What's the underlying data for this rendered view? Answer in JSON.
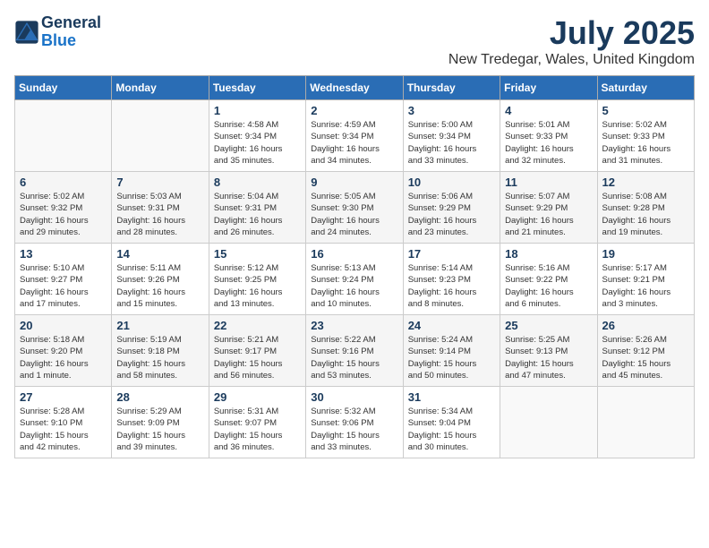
{
  "header": {
    "logo_line1": "General",
    "logo_line2": "Blue",
    "month_year": "July 2025",
    "location": "New Tredegar, Wales, United Kingdom"
  },
  "weekdays": [
    "Sunday",
    "Monday",
    "Tuesday",
    "Wednesday",
    "Thursday",
    "Friday",
    "Saturday"
  ],
  "weeks": [
    [
      {
        "day": "",
        "info": ""
      },
      {
        "day": "",
        "info": ""
      },
      {
        "day": "1",
        "info": "Sunrise: 4:58 AM\nSunset: 9:34 PM\nDaylight: 16 hours\nand 35 minutes."
      },
      {
        "day": "2",
        "info": "Sunrise: 4:59 AM\nSunset: 9:34 PM\nDaylight: 16 hours\nand 34 minutes."
      },
      {
        "day": "3",
        "info": "Sunrise: 5:00 AM\nSunset: 9:34 PM\nDaylight: 16 hours\nand 33 minutes."
      },
      {
        "day": "4",
        "info": "Sunrise: 5:01 AM\nSunset: 9:33 PM\nDaylight: 16 hours\nand 32 minutes."
      },
      {
        "day": "5",
        "info": "Sunrise: 5:02 AM\nSunset: 9:33 PM\nDaylight: 16 hours\nand 31 minutes."
      }
    ],
    [
      {
        "day": "6",
        "info": "Sunrise: 5:02 AM\nSunset: 9:32 PM\nDaylight: 16 hours\nand 29 minutes."
      },
      {
        "day": "7",
        "info": "Sunrise: 5:03 AM\nSunset: 9:31 PM\nDaylight: 16 hours\nand 28 minutes."
      },
      {
        "day": "8",
        "info": "Sunrise: 5:04 AM\nSunset: 9:31 PM\nDaylight: 16 hours\nand 26 minutes."
      },
      {
        "day": "9",
        "info": "Sunrise: 5:05 AM\nSunset: 9:30 PM\nDaylight: 16 hours\nand 24 minutes."
      },
      {
        "day": "10",
        "info": "Sunrise: 5:06 AM\nSunset: 9:29 PM\nDaylight: 16 hours\nand 23 minutes."
      },
      {
        "day": "11",
        "info": "Sunrise: 5:07 AM\nSunset: 9:29 PM\nDaylight: 16 hours\nand 21 minutes."
      },
      {
        "day": "12",
        "info": "Sunrise: 5:08 AM\nSunset: 9:28 PM\nDaylight: 16 hours\nand 19 minutes."
      }
    ],
    [
      {
        "day": "13",
        "info": "Sunrise: 5:10 AM\nSunset: 9:27 PM\nDaylight: 16 hours\nand 17 minutes."
      },
      {
        "day": "14",
        "info": "Sunrise: 5:11 AM\nSunset: 9:26 PM\nDaylight: 16 hours\nand 15 minutes."
      },
      {
        "day": "15",
        "info": "Sunrise: 5:12 AM\nSunset: 9:25 PM\nDaylight: 16 hours\nand 13 minutes."
      },
      {
        "day": "16",
        "info": "Sunrise: 5:13 AM\nSunset: 9:24 PM\nDaylight: 16 hours\nand 10 minutes."
      },
      {
        "day": "17",
        "info": "Sunrise: 5:14 AM\nSunset: 9:23 PM\nDaylight: 16 hours\nand 8 minutes."
      },
      {
        "day": "18",
        "info": "Sunrise: 5:16 AM\nSunset: 9:22 PM\nDaylight: 16 hours\nand 6 minutes."
      },
      {
        "day": "19",
        "info": "Sunrise: 5:17 AM\nSunset: 9:21 PM\nDaylight: 16 hours\nand 3 minutes."
      }
    ],
    [
      {
        "day": "20",
        "info": "Sunrise: 5:18 AM\nSunset: 9:20 PM\nDaylight: 16 hours\nand 1 minute."
      },
      {
        "day": "21",
        "info": "Sunrise: 5:19 AM\nSunset: 9:18 PM\nDaylight: 15 hours\nand 58 minutes."
      },
      {
        "day": "22",
        "info": "Sunrise: 5:21 AM\nSunset: 9:17 PM\nDaylight: 15 hours\nand 56 minutes."
      },
      {
        "day": "23",
        "info": "Sunrise: 5:22 AM\nSunset: 9:16 PM\nDaylight: 15 hours\nand 53 minutes."
      },
      {
        "day": "24",
        "info": "Sunrise: 5:24 AM\nSunset: 9:14 PM\nDaylight: 15 hours\nand 50 minutes."
      },
      {
        "day": "25",
        "info": "Sunrise: 5:25 AM\nSunset: 9:13 PM\nDaylight: 15 hours\nand 47 minutes."
      },
      {
        "day": "26",
        "info": "Sunrise: 5:26 AM\nSunset: 9:12 PM\nDaylight: 15 hours\nand 45 minutes."
      }
    ],
    [
      {
        "day": "27",
        "info": "Sunrise: 5:28 AM\nSunset: 9:10 PM\nDaylight: 15 hours\nand 42 minutes."
      },
      {
        "day": "28",
        "info": "Sunrise: 5:29 AM\nSunset: 9:09 PM\nDaylight: 15 hours\nand 39 minutes."
      },
      {
        "day": "29",
        "info": "Sunrise: 5:31 AM\nSunset: 9:07 PM\nDaylight: 15 hours\nand 36 minutes."
      },
      {
        "day": "30",
        "info": "Sunrise: 5:32 AM\nSunset: 9:06 PM\nDaylight: 15 hours\nand 33 minutes."
      },
      {
        "day": "31",
        "info": "Sunrise: 5:34 AM\nSunset: 9:04 PM\nDaylight: 15 hours\nand 30 minutes."
      },
      {
        "day": "",
        "info": ""
      },
      {
        "day": "",
        "info": ""
      }
    ]
  ]
}
